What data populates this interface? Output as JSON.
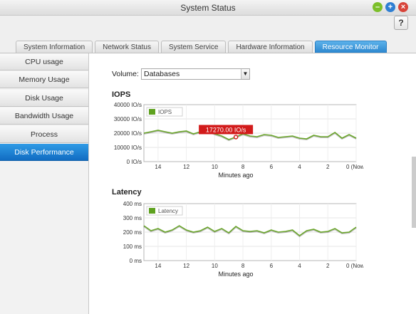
{
  "window": {
    "title": "System Status"
  },
  "header": {
    "help_label": "?"
  },
  "tabs": [
    "System Information",
    "Network Status",
    "System Service",
    "Hardware Information",
    "Resource Monitor"
  ],
  "sidebar": {
    "items": [
      "CPU usage",
      "Memory Usage",
      "Disk Usage",
      "Bandwidth Usage",
      "Process",
      "Disk Performance"
    ]
  },
  "volume": {
    "label": "Volume:",
    "value": "Databases"
  },
  "iops": {
    "section_title": "IOPS",
    "tooltip": "17270.00 IO/s"
  },
  "latency": {
    "section_title": "Latency"
  },
  "colors": {
    "line": "#6aa62a",
    "legend": "#5ea11f",
    "accent": "#2a87d3",
    "tooltip": "#d21b1b"
  },
  "chart_data": [
    {
      "type": "line",
      "title": "IOPS",
      "xlabel": "Minutes ago",
      "ylabel": "",
      "x_ticks": [
        "14",
        "12",
        "10",
        "8",
        "6",
        "4",
        "2",
        "0 (Now)"
      ],
      "y_ticks": [
        "40000 IO/s",
        "30000 IO/s",
        "20000 IO/s",
        "10000 IO/s",
        "0 IO/s"
      ],
      "xlim": [
        15,
        0
      ],
      "ylim": [
        0,
        40000
      ],
      "legend": "top-left",
      "series": [
        {
          "name": "IOPS",
          "x": [
            15,
            14.5,
            14,
            13.5,
            13,
            12.5,
            12,
            11.5,
            11,
            10.5,
            10,
            9.5,
            9,
            8.5,
            8,
            7.5,
            7,
            6.5,
            6,
            5.5,
            5,
            4.5,
            4,
            3.5,
            3,
            2.5,
            2,
            1.5,
            1,
            0.5,
            0
          ],
          "y": [
            20000,
            21000,
            22000,
            21000,
            20000,
            21000,
            21500,
            19500,
            21000,
            22000,
            19500,
            18000,
            15500,
            17270,
            19500,
            18000,
            17500,
            19000,
            18500,
            17000,
            17500,
            18000,
            16500,
            16000,
            18500,
            17500,
            17500,
            20500,
            16500,
            19000,
            16500
          ]
        }
      ]
    },
    {
      "type": "line",
      "title": "Latency",
      "xlabel": "Minutes ago",
      "ylabel": "",
      "x_ticks": [
        "14",
        "12",
        "10",
        "8",
        "6",
        "4",
        "2",
        "0 (Now)"
      ],
      "y_ticks": [
        "400 ms",
        "300 ms",
        "200 ms",
        "100 ms",
        "0 ms"
      ],
      "xlim": [
        15,
        0
      ],
      "ylim": [
        0,
        400
      ],
      "legend": "top-left",
      "series": [
        {
          "name": "Latency",
          "x": [
            15,
            14.5,
            14,
            13.5,
            13,
            12.5,
            12,
            11.5,
            11,
            10.5,
            10,
            9.5,
            9,
            8.5,
            8,
            7.5,
            7,
            6.5,
            6,
            5.5,
            5,
            4.5,
            4,
            3.5,
            3,
            2.5,
            2,
            1.5,
            1,
            0.5,
            0
          ],
          "y": [
            245,
            210,
            225,
            200,
            215,
            245,
            215,
            200,
            210,
            235,
            205,
            225,
            195,
            240,
            210,
            205,
            210,
            195,
            215,
            200,
            205,
            215,
            175,
            210,
            220,
            200,
            205,
            225,
            195,
            200,
            235
          ]
        }
      ]
    }
  ]
}
